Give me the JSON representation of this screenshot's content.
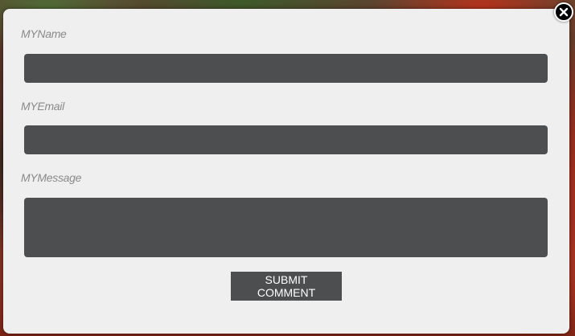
{
  "form": {
    "name_label": "MYName",
    "name_value": "",
    "email_label": "MYEmail",
    "email_value": "",
    "message_label": "MYMessage",
    "message_value": "",
    "submit_label": "SUBMIT COMMENT"
  },
  "icons": {
    "close": "close-icon"
  },
  "colors": {
    "modal_bg": "#efefef",
    "field_bg": "#4d4e4f",
    "label_text": "#8a8a8a",
    "button_text": "#ffffff"
  }
}
